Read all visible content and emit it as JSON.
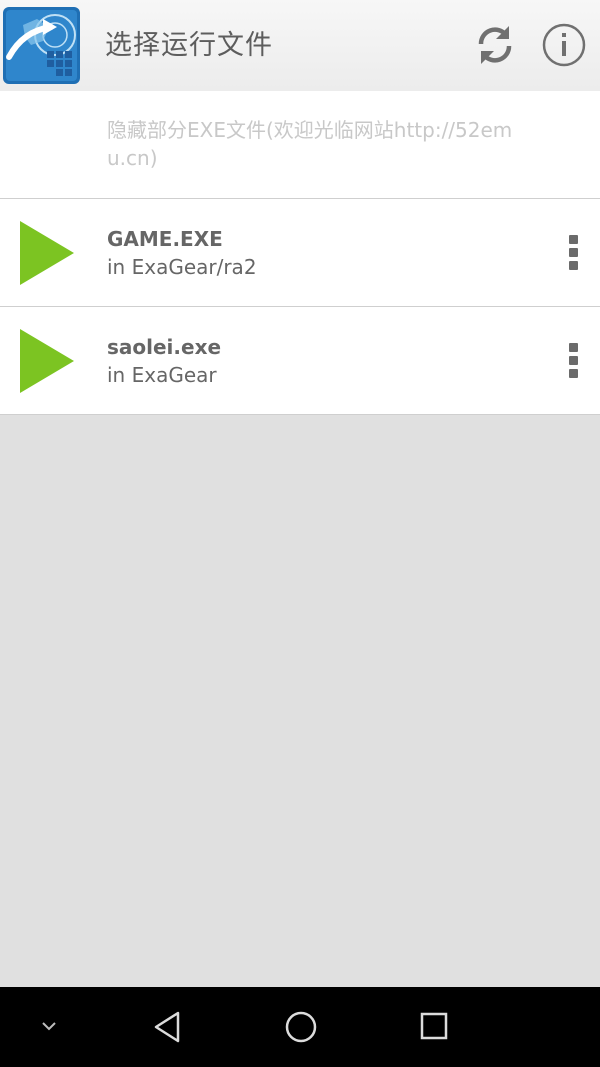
{
  "header": {
    "title": "选择运行文件",
    "app_icon": "exagear-app-icon",
    "refresh_icon": "refresh-icon",
    "info_icon": "info-icon"
  },
  "notice": {
    "text": "隐藏部分EXE文件(欢迎光临网站http://52emu.cn)"
  },
  "files": [
    {
      "name": "GAME.EXE",
      "location": "in ExaGear/ra2"
    },
    {
      "name": "saolei.exe",
      "location": "in ExaGear"
    }
  ],
  "navbar": {
    "icons": [
      "chevron-down-icon",
      "back-icon",
      "home-icon",
      "recents-icon"
    ]
  },
  "colors": {
    "play_green": "#7cc422",
    "title_text": "#5d5d5d",
    "notice_text": "#c8c8c8",
    "background": "#e0e0e0"
  }
}
